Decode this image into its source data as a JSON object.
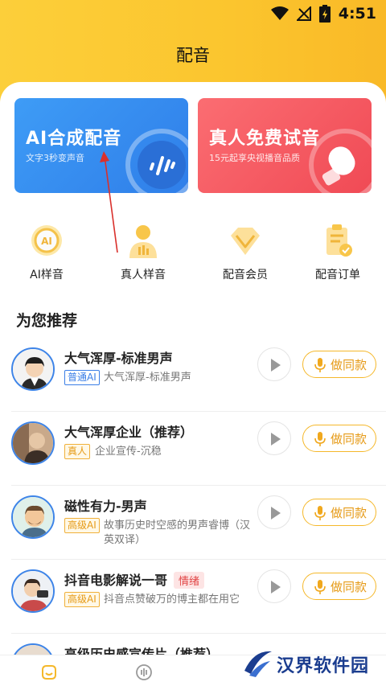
{
  "status_bar": {
    "time": "4:51"
  },
  "header": {
    "title": "配音"
  },
  "banners": [
    {
      "title": "AI合成配音",
      "subtitle": "文字3秒变声音"
    },
    {
      "title": "真人免费试音",
      "subtitle": "15元起享央视播音品质"
    }
  ],
  "quick_actions": [
    {
      "label": "AI样音"
    },
    {
      "label": "真人样音"
    },
    {
      "label": "配音会员"
    },
    {
      "label": "配音订单"
    }
  ],
  "recommend": {
    "title": "为您推荐",
    "same_label": "做同款",
    "items": [
      {
        "name": "大气浑厚-标准男声",
        "badge": "普通AI",
        "desc": "大气浑厚-标准男声",
        "tag": ""
      },
      {
        "name": "大气浑厚企业（推荐）",
        "badge": "真人",
        "desc": "企业宣传-沉稳",
        "tag": ""
      },
      {
        "name": "磁性有力-男声",
        "badge": "高级AI",
        "desc": "故事历史时空感的男声睿博（汉英双译）",
        "tag": ""
      },
      {
        "name": "抖音电影解说一哥",
        "badge": "高级AI",
        "desc": "抖音点赞破万的博主都在用它",
        "tag": "情绪"
      },
      {
        "name": "高级历史感宣传片（推荐）",
        "badge": "",
        "desc": "",
        "tag": ""
      }
    ]
  },
  "watermark": {
    "text": "汉界软件园"
  },
  "colors": {
    "accent": "#f5b82b",
    "blue": "#3a7ee6",
    "red": "#f04a55"
  }
}
